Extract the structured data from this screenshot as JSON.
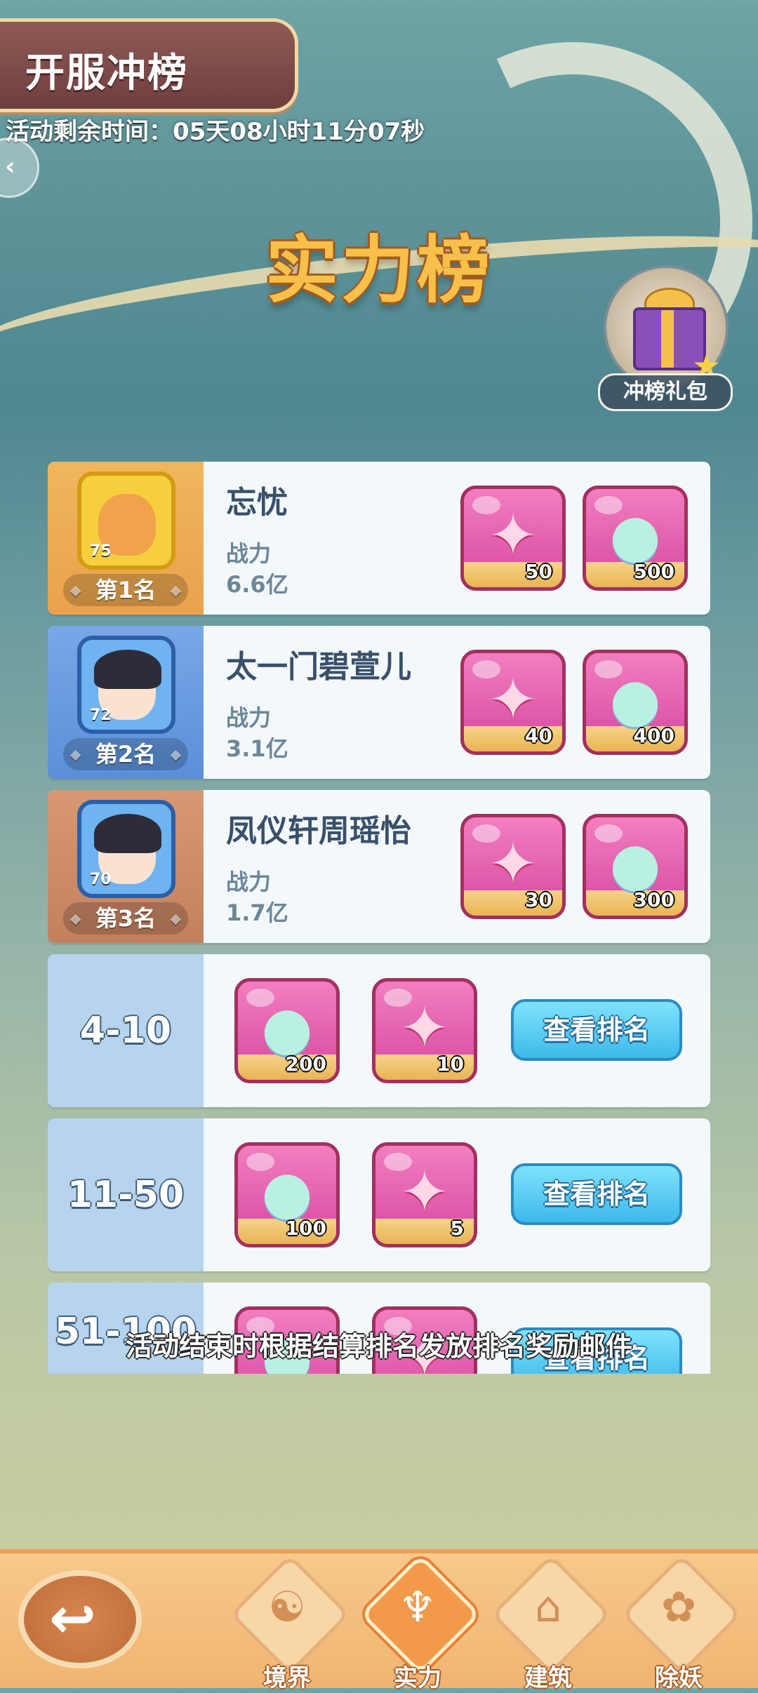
{
  "header": {
    "banner_title": "开服冲榜",
    "timer_text": "活动剩余时间：05天08小时11分07秒",
    "main_title": "实力榜"
  },
  "gift": {
    "label": "冲榜礼包",
    "icon": "gift-box-icon"
  },
  "top_ranks": [
    {
      "rank_label": "第1名",
      "name": "忘忧",
      "power_label": "战力",
      "power": "6.6亿",
      "level": "75",
      "rewards": [
        {
          "icon": "puzzle-icon",
          "qty": "50"
        },
        {
          "icon": "fruit-icon",
          "qty": "500"
        }
      ]
    },
    {
      "rank_label": "第2名",
      "name": "太一门碧萱儿",
      "power_label": "战力",
      "power": "3.1亿",
      "level": "72",
      "rewards": [
        {
          "icon": "puzzle-icon",
          "qty": "40"
        },
        {
          "icon": "fruit-icon",
          "qty": "400"
        }
      ]
    },
    {
      "rank_label": "第3名",
      "name": "凤仪轩周瑶怡",
      "power_label": "战力",
      "power": "1.7亿",
      "level": "70",
      "rewards": [
        {
          "icon": "puzzle-icon",
          "qty": "30"
        },
        {
          "icon": "fruit-icon",
          "qty": "300"
        }
      ]
    }
  ],
  "range_ranks": [
    {
      "range": "4-10",
      "rewards": [
        {
          "icon": "fruit-icon",
          "qty": "200"
        },
        {
          "icon": "puzzle-icon",
          "qty": "10"
        }
      ],
      "button": "查看排名"
    },
    {
      "range": "11-50",
      "rewards": [
        {
          "icon": "fruit-icon",
          "qty": "100"
        },
        {
          "icon": "puzzle-icon",
          "qty": "5"
        }
      ],
      "button": "查看排名"
    },
    {
      "range": "51-100",
      "rewards": [],
      "button": "查看排名"
    }
  ],
  "notice": "活动结束时根据结算排名发放排名奖励邮件",
  "nav": {
    "back_icon": "back-arrow-icon",
    "tabs": [
      {
        "label": "境界",
        "icon": "yinyang-icon"
      },
      {
        "label": "实力",
        "icon": "trident-icon"
      },
      {
        "label": "建筑",
        "icon": "pagoda-icon"
      },
      {
        "label": "除妖",
        "icon": "paw-icon"
      }
    ],
    "active_tab": "实力"
  },
  "colors": {
    "gold": "#f1b65c",
    "silver_blue": "#79a7e6",
    "bronze": "#d79873",
    "button_blue": "#3eb9ea",
    "title_gold": "#f7c04a"
  }
}
